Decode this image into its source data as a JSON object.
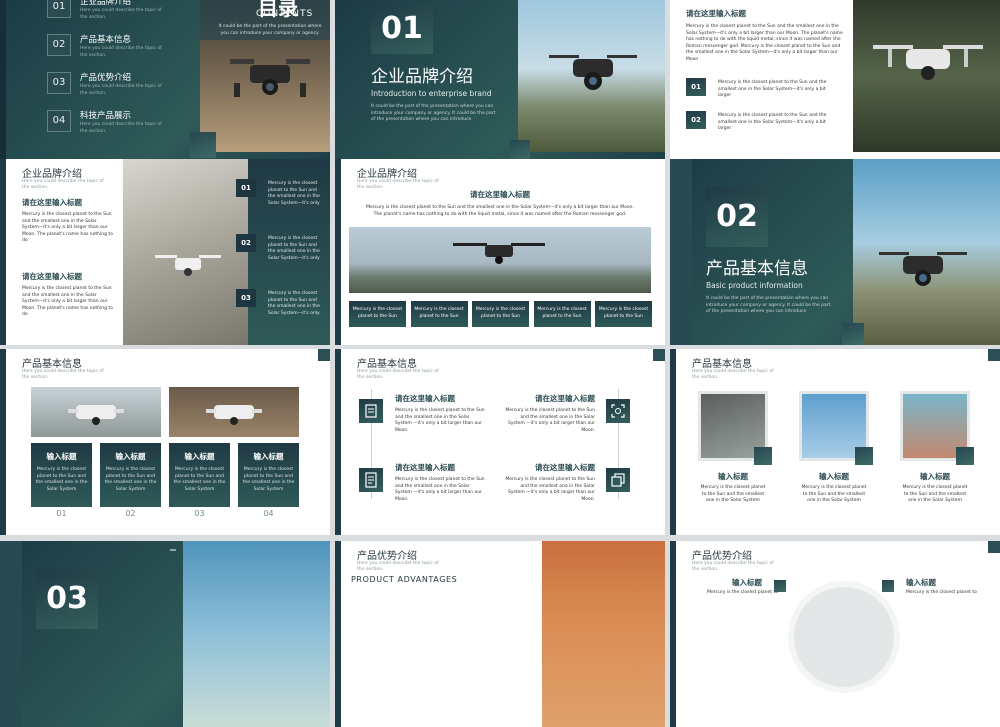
{
  "toc": {
    "title": "目录",
    "contents": "CONTENTS",
    "desc": "It could be the part of the presentation where you can introduce your company or agency.",
    "items": [
      {
        "num": "01",
        "label": "企业品牌介绍",
        "sub": "Here you could describe the topic of the section."
      },
      {
        "num": "02",
        "label": "产品基本信息",
        "sub": "Here you could describe the topic of the section."
      },
      {
        "num": "03",
        "label": "产品优势介绍",
        "sub": "Here you could describe the topic of the section."
      },
      {
        "num": "04",
        "label": "科技产品展示",
        "sub": "Here you could describe the topic of the section."
      }
    ]
  },
  "section1": {
    "num": "01",
    "title": "企业品牌介绍",
    "en": "Introduction to enterprise brand",
    "desc": "It could be the part of the presentation where you can introduce your company or agency. It could be the part of the presentation where you can introduce"
  },
  "slide3": {
    "heading": "请在这里输入标题",
    "body": "Mercury is the closest planet to the Sun and the smallest one in the Solar System—it's only a bit larger than our Moon. The planet's name has nothing to do with the liquid metal, since it was named after the Roman messenger god. Mercury is the closest planet to the Sun and the smallest one in the Solar System—it's only a bit larger than our Moon",
    "items": [
      {
        "num": "01",
        "text": "Mercury is the closest planet to the Sun and the smallest one in the Solar System—it's only a bit larger"
      },
      {
        "num": "02",
        "text": "Mercury is the closest planet to the Sun and the smallest one in the Solar System—it's only a bit larger"
      }
    ]
  },
  "slide4": {
    "header": "企业品牌介绍",
    "sub": "Here you could describe the topic of the section.",
    "blocks": [
      {
        "title": "请在这里输入标题",
        "text": "Mercury is the closest planet to the Sun and the smallest one in the Solar System—it's only a bit larger than our Moon. The planet's name has nothing to do"
      },
      {
        "title": "请在这里输入标题",
        "text": "Mercury is the closest planet to the Sun and the smallest one in the Solar System—it's only a bit larger than our Moon. The planet's name has nothing to do"
      }
    ],
    "items": [
      {
        "num": "01",
        "text": "Mercury is the closest planet to the Sun and the smallest one in the Solar System—it's only"
      },
      {
        "num": "02",
        "text": "Mercury is the closest planet to the Sun and the smallest one in the Solar System—it's only"
      },
      {
        "num": "03",
        "text": "Mercury is the closest planet to the Sun and the smallest one in the Solar System—it's only"
      }
    ]
  },
  "slide5": {
    "header": "企业品牌介绍",
    "sub": "Here you could describe the topic of the section.",
    "title": "请在这里输入标题",
    "body": "Mercury is the closest planet to the Sun and the smallest one in the Solar System—it's only a bit larger than our Moon. The planet's name has nothing to do with the liquid metal, since it was named after the Roman messenger god.",
    "cards": [
      "Mercury is the closest planet to the Sun",
      "Mercury is the closest planet to the Sun",
      "Mercury is the closest planet to the Sun",
      "Mercury is the closest planet to the Sun",
      "Mercury is the closest planet to the Sun"
    ]
  },
  "section2": {
    "num": "02",
    "title": "产品基本信息",
    "en": "Basic product information",
    "desc": "It could be the part of the presentation where you can introduce your company or agency. It could be the part of the presentation where you can introduce"
  },
  "slide7": {
    "header": "产品基本信息",
    "sub": "Here you could describe the topic of the section.",
    "cards": [
      {
        "title": "输入标题",
        "text": "Mercury is the closest planet to the Sun and the smallest one in the Solar System",
        "num": "01"
      },
      {
        "title": "输入标题",
        "text": "Mercury is the closest planet to the Sun and the smallest one in the Solar System",
        "num": "02"
      },
      {
        "title": "输入标题",
        "text": "Mercury is the closest planet to the Sun and the smallest one in the Solar System",
        "num": "03"
      },
      {
        "title": "输入标题",
        "text": "Mercury is the closest planet to the Sun and the smallest one in the Solar System",
        "num": "04"
      }
    ]
  },
  "slide8": {
    "header": "产品基本信息",
    "sub": "Here you could describe the topic of the section.",
    "blocks": [
      {
        "title": "请在这里输入标题",
        "text": "Mercury is the closest planet to the Sun and the smallest one in the Solar System —it's only a bit larger than our Moon."
      },
      {
        "title": "请在这里输入标题",
        "text": "Mercury is the closest planet to the Sun and the smallest one in the Solar System —it's only a bit larger than our Moon."
      },
      {
        "title": "请在这里输入标题",
        "text": "Mercury is the closest planet to the Sun and the smallest one in the Solar System —it's only a bit larger than our Moon."
      },
      {
        "title": "请在这里输入标题",
        "text": "Mercury is the closest planet to the Sun and the smallest one in the Solar System —it's only a bit larger than our Moon."
      }
    ]
  },
  "slide9": {
    "header": "产品基本信息",
    "sub": "Here you could describe the topic of the section.",
    "items": [
      {
        "title": "输入标题",
        "text": "Mercury is the closest planet to the Sun and the smallest one in the Solar System"
      },
      {
        "title": "输入标题",
        "text": "Mercury is the closest planet to the Sun and the smallest one in the Solar System"
      },
      {
        "title": "输入标题",
        "text": "Mercury is the closest planet to the Sun and the smallest one in the Solar System"
      }
    ]
  },
  "section3": {
    "num": "03"
  },
  "slide11": {
    "header": "产品优势介绍",
    "sub": "Here you could describe the topic of the section.",
    "en": "PRODUCT ADVANTAGES"
  },
  "slide12": {
    "header": "产品优势介绍",
    "sub": "Here you could describe the topic of the section.",
    "left": {
      "title": "输入标题",
      "text": "Mercury is the closest planet to"
    },
    "right": {
      "title": "输入标题",
      "text": "Mercury is the closest planet to"
    }
  }
}
